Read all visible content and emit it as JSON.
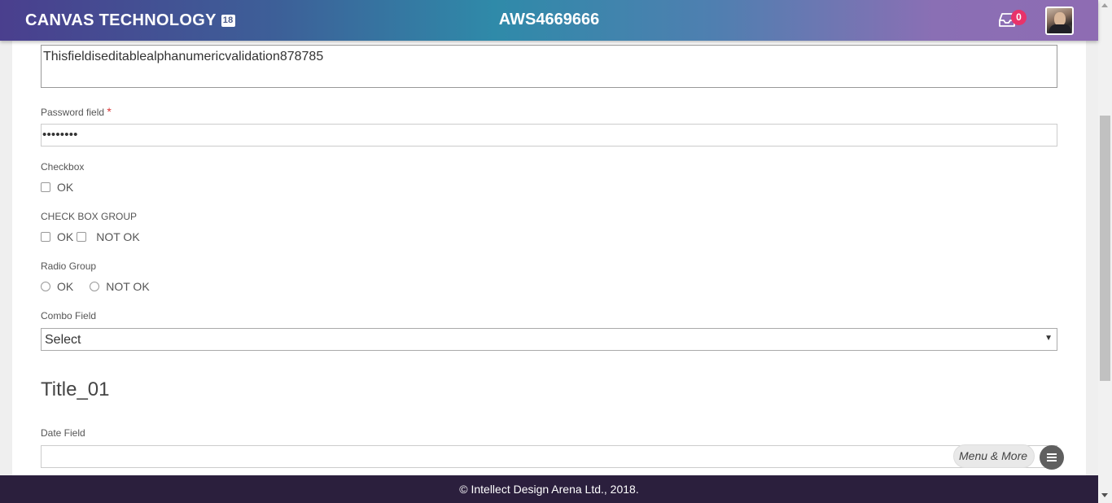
{
  "header": {
    "brand": "CANVAS TECHNOLOGY",
    "brand_badge": "18",
    "app_id": "AWS4669666",
    "inbox_icon": "inbox-icon",
    "inbox_count": "0"
  },
  "form": {
    "textarea_value": "Thisfieldiseditablealphanumericvalidation878785",
    "password": {
      "label": "Password field",
      "required_mark": "*",
      "value": "••••••••"
    },
    "checkbox": {
      "label": "Checkbox",
      "options": [
        "OK"
      ]
    },
    "checkbox_group": {
      "label": "CHECK BOX GROUP",
      "options": [
        "OK",
        "NOT OK"
      ]
    },
    "radio_group": {
      "label": "Radio Group",
      "options": [
        "OK",
        "NOT OK"
      ]
    },
    "combo": {
      "label": "Combo Field",
      "value": "Select"
    },
    "section_title": "Title_01",
    "date": {
      "label": "Date Field",
      "value": ""
    }
  },
  "menu": {
    "label": "Menu & More",
    "icon": "hamburger-icon"
  },
  "footer": {
    "text": "© Intellect Design Arena Ltd., 2018."
  },
  "colors": {
    "badge": "#e8336a",
    "footer_bg": "#2b1f3d",
    "required": "#d93535"
  }
}
